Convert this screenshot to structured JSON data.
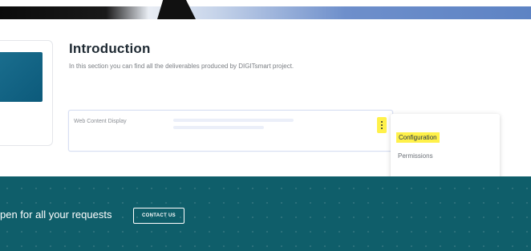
{
  "intro": {
    "title": "Introduction",
    "description": "In this section you can find all the deliverables produced by DIGITsmart project."
  },
  "web_content": {
    "label": "Web Content Display",
    "options_icon": "vertical-ellipsis-icon"
  },
  "menu": {
    "items": [
      {
        "label": "Configuration",
        "highlighted": true
      },
      {
        "label": "Permissions",
        "highlighted": false
      }
    ]
  },
  "footer": {
    "text": "pen for all your requests",
    "contact_label": "CONTACT US"
  },
  "colors": {
    "highlight": "#fff14a",
    "footer_bg": "#0f5e6a",
    "left_card_image": "#1b6f8f"
  }
}
